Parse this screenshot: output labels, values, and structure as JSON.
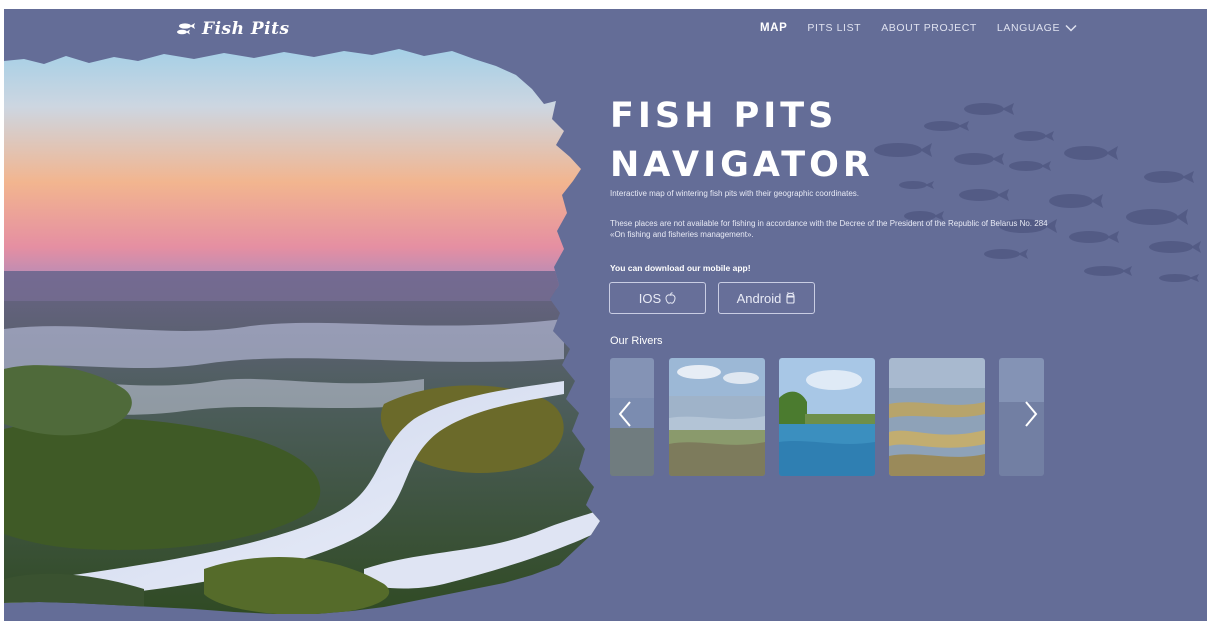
{
  "header": {
    "logo_text": "Fish Pits",
    "nav": {
      "map": "MAP",
      "pits_list": "PITS LIST",
      "about": "ABOUT PROJECT",
      "language": "LANGUAGE"
    }
  },
  "hero": {
    "title_line1": "FISH PITS",
    "title_line2": "NAVIGATOR",
    "subtitle": "Interactive map of wintering fish pits with their geographic coordinates.",
    "notice": "These places are not available for fishing in accordance with the Decree of the President of the Republic of Belarus No. 284 «On fishing and fisheries management».",
    "download_label": "You can download our mobile app!",
    "ios_label": "IOS",
    "android_label": "Android"
  },
  "rivers": {
    "title": "Our Rivers",
    "cards": [
      {
        "icon": "river-thumbnail",
        "state": "faded"
      },
      {
        "icon": "river-thumbnail",
        "state": "normal"
      },
      {
        "icon": "river-thumbnail",
        "state": "active"
      },
      {
        "icon": "river-thumbnail",
        "state": "normal"
      },
      {
        "icon": "river-thumbnail",
        "state": "faded"
      }
    ]
  },
  "colors": {
    "background": "#646d97",
    "text": "#ffffff",
    "button_border": "#c9cde3"
  }
}
